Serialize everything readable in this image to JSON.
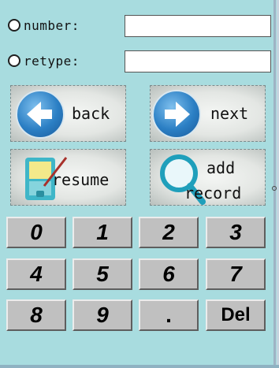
{
  "form": {
    "number_label": "number:",
    "retype_label": "retype:",
    "number_value": "",
    "retype_value": ""
  },
  "actions": {
    "back_label": "back",
    "next_label": "next",
    "resume_label": "resume",
    "add_record_line1": "add",
    "add_record_line2": "record"
  },
  "keypad": {
    "keys": [
      "0",
      "1",
      "2",
      "3",
      "4",
      "5",
      "6",
      "7",
      "8",
      "9",
      ".",
      "Del"
    ]
  },
  "icons": {
    "back": "back-arrow-icon",
    "next": "next-arrow-icon",
    "resume": "document-pen-icon",
    "add_record": "magnifier-icon"
  },
  "colors": {
    "background": "#a8dcdf",
    "key_face": "#c0c0c0",
    "icon_blue": "#2b7fc4"
  }
}
